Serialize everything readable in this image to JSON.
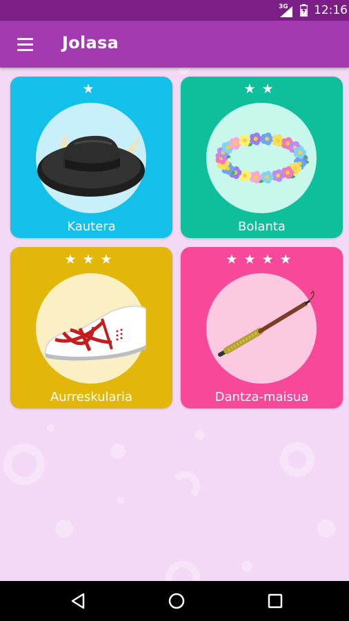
{
  "status_bar": {
    "network": "3G",
    "time": "12:16"
  },
  "app_bar": {
    "title": "Jolasa",
    "menu_icon": "hamburger-menu-icon"
  },
  "levels": [
    {
      "label": "Kautera",
      "stars": "★",
      "star_count": 1,
      "color": "#12c0ea",
      "circle_color": "#c9f0fa",
      "icon": "hat-with-horns"
    },
    {
      "label": "Bolanta",
      "stars": "★★",
      "star_count": 2,
      "color": "#0fbf9b",
      "circle_color": "#c8f7ec",
      "icon": "flower-wreath"
    },
    {
      "label": "Aurreskularia",
      "stars": "★★★",
      "star_count": 3,
      "color": "#e2b70a",
      "circle_color": "#fbf0c4",
      "icon": "dance-shoe"
    },
    {
      "label": "Dantza-maisua",
      "stars": "★★★★",
      "star_count": 4,
      "color": "#f7489a",
      "circle_color": "#fcc9e0",
      "icon": "master-baton"
    }
  ],
  "nav": {
    "back_icon": "back-triangle-icon",
    "home_icon": "home-circle-icon",
    "recents_icon": "recents-square-icon"
  }
}
